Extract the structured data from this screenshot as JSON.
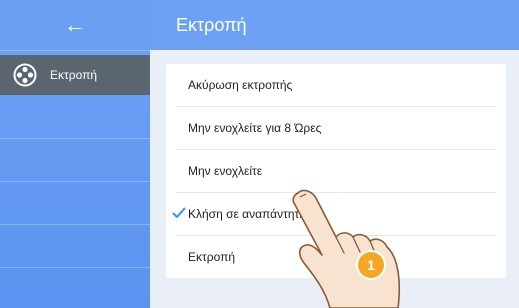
{
  "header": {
    "title": "Εκτροπή",
    "back_icon": "←"
  },
  "sidebar": {
    "items": [
      {
        "label": "Εκτροπή",
        "icon": "film-reel-icon",
        "selected": true
      }
    ]
  },
  "menu": {
    "options": [
      {
        "label": "Ακύρωση εκτροπής",
        "checked": false
      },
      {
        "label": "Μην ενοχλείτε για 8 Ώρες",
        "checked": false
      },
      {
        "label": "Μην ενοχλείτε",
        "checked": false
      },
      {
        "label": "Κλήση σε αναπάντητη",
        "checked": true
      },
      {
        "label": "Εκτροπή",
        "checked": false
      }
    ]
  },
  "annotation": {
    "step_number": "1"
  },
  "colors": {
    "header_blue": "#6da1f4",
    "sidebar_selected": "#5a6570",
    "check": "#2a9bf0",
    "badge": "#f5a623"
  }
}
